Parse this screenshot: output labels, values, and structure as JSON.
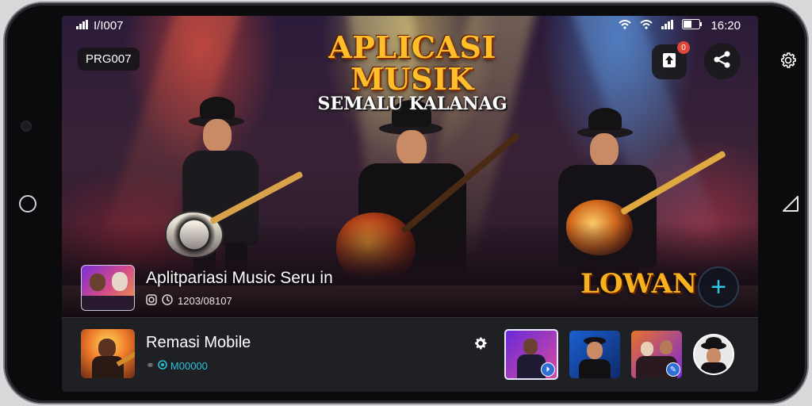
{
  "status_bar": {
    "left_text": "I/I007",
    "time": "16:20",
    "icons": [
      "signal-icon",
      "wifi-icon",
      "wifi-icon",
      "signal-icon",
      "battery-icon"
    ]
  },
  "hero": {
    "code_badge": "PRG007",
    "title_main": "APLICASI MUSIK",
    "title_sub": "SEMALU KALANAG",
    "upload_notification_count": "0",
    "track": {
      "title": "Aplitpariasi Music Seru in",
      "meta": "1203/08107"
    },
    "cta_label": "LOWAN",
    "fab_symbol": "+",
    "colors": {
      "title": "#ffbf2a",
      "cta": "#f6b21c",
      "fab": "#2fc6e6"
    }
  },
  "now_playing": {
    "title": "Remasi Mobile",
    "meta": "M00000",
    "meta_color": "#2bc0d8"
  },
  "thumbnails": [
    {
      "name": "mini-thumb-1",
      "badge": "⏵"
    },
    {
      "name": "mini-thumb-2",
      "badge": ""
    },
    {
      "name": "mini-thumb-3",
      "badge": "✎"
    }
  ]
}
